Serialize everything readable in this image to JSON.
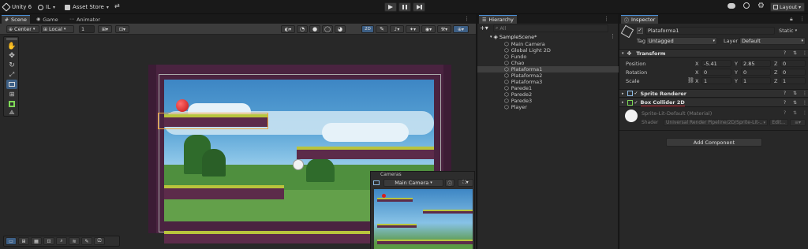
{
  "toolbar": {
    "unity_label": "Unity 6",
    "account_label": "IL",
    "asset_store_label": "Asset Store",
    "layout_label": "Layout"
  },
  "scene_tabs": [
    {
      "label": "Scene"
    },
    {
      "label": "Game"
    },
    {
      "label": "Animator"
    }
  ],
  "scene_toolbar": {
    "pivot_mode": "Center",
    "pivot_rotation": "Local",
    "grid_size": "1"
  },
  "camera_preview": {
    "title": "Cameras",
    "camera_select": "Main Camera"
  },
  "hierarchy": {
    "tab_label": "Hierarchy",
    "search_placeholder": "All",
    "scene_name": "SampleScene*",
    "items": [
      {
        "label": "Main Camera"
      },
      {
        "label": "Global Light 2D"
      },
      {
        "label": "Fundo"
      },
      {
        "label": "Chao"
      },
      {
        "label": "Plataforma1"
      },
      {
        "label": "Plataforma2"
      },
      {
        "label": "Plataforma3"
      },
      {
        "label": "Parede1"
      },
      {
        "label": "Parede2"
      },
      {
        "label": "Parede3"
      },
      {
        "label": "Player"
      }
    ],
    "selected_index": 4
  },
  "inspector": {
    "tab_label": "Inspector",
    "object_name": "Plataforma1",
    "static_label": "Static",
    "tag_label": "Tag",
    "tag_value": "Untagged",
    "layer_label": "Layer",
    "layer_value": "Default",
    "transform": {
      "title": "Transform",
      "rows": [
        {
          "label": "Position",
          "x": "-5.41",
          "y": "2.85",
          "z": "0"
        },
        {
          "label": "Rotation",
          "x": "0",
          "y": "0",
          "z": "0"
        },
        {
          "label": "Scale",
          "x": "1",
          "y": "1",
          "z": "1"
        }
      ],
      "axis_x": "X",
      "axis_y": "Y",
      "axis_z": "Z"
    },
    "sprite_renderer_title": "Sprite Renderer",
    "box_collider_title": "Box Collider 2D",
    "material_name": "Sprite-Lit-Default (Material)",
    "shader_label": "Shader",
    "shader_value": "Universal Render Pipeline/2D/Sprite-Lit-...",
    "edit_label": "Edit...",
    "add_component_label": "Add Component"
  },
  "colors": {
    "accent": "#4a90d9",
    "selection": "#2c5d87",
    "panel": "#282828",
    "error_underline": "#c8323c"
  }
}
